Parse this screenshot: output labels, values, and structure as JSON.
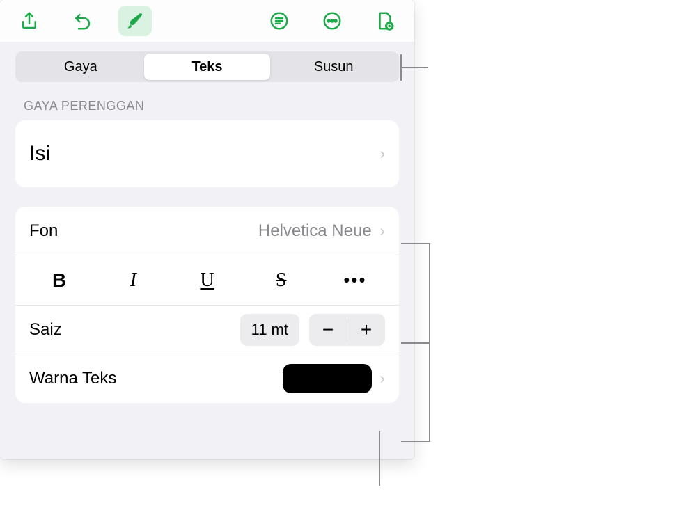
{
  "toolbar": {
    "icons": {
      "share": "share-icon",
      "undo": "undo-icon",
      "brush": "brush-icon",
      "paragraph": "paragraph-icon",
      "more": "more-icon",
      "document": "document-icon"
    }
  },
  "tabs": {
    "items": [
      {
        "label": "Gaya",
        "active": false
      },
      {
        "label": "Teks",
        "active": true
      },
      {
        "label": "Susun",
        "active": false
      }
    ]
  },
  "sections": {
    "paragraph_style": {
      "header": "GAYA PERENGGAN",
      "value": "Isi"
    },
    "font": {
      "label": "Fon",
      "value": "Helvetica Neue"
    },
    "style_buttons": {
      "bold": "B",
      "italic": "I",
      "underline": "U",
      "strike": "S",
      "more": "•••"
    },
    "size": {
      "label": "Saiz",
      "value": "11 mt",
      "minus": "−",
      "plus": "+"
    },
    "text_color": {
      "label": "Warna Teks",
      "color": "#000000"
    }
  }
}
